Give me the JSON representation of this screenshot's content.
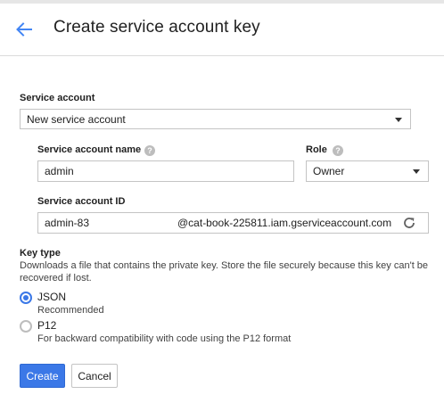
{
  "header": {
    "title": "Create service account key",
    "back_icon": "arrow-back-icon"
  },
  "service_account": {
    "label": "Service account",
    "selected": "New service account"
  },
  "account_name": {
    "label": "Service account name",
    "value": "admin"
  },
  "role": {
    "label": "Role",
    "selected": "Owner"
  },
  "account_id": {
    "label": "Service account ID",
    "value": "admin-83",
    "suffix": "@cat-book-225811.iam.gserviceaccount.com"
  },
  "key_type": {
    "label": "Key type",
    "description": "Downloads a file that contains the private key. Store the file securely because this key can't be recovered if lost.",
    "options": [
      {
        "label": "JSON",
        "sublabel": "Recommended",
        "checked": true
      },
      {
        "label": "P12",
        "sublabel": "For backward compatibility with code using the P12 format",
        "checked": false
      }
    ]
  },
  "buttons": {
    "create": "Create",
    "cancel": "Cancel"
  },
  "colors": {
    "accent": "#3b78e7",
    "border": "#c4c4c4"
  }
}
